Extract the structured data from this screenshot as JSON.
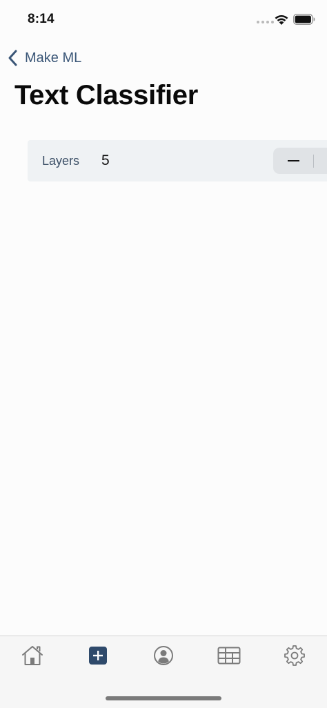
{
  "status_bar": {
    "time": "8:14"
  },
  "nav": {
    "back_label": "Make ML",
    "title": "Text Classifier"
  },
  "layers": {
    "label": "Layers",
    "value": "5"
  },
  "tab_bar": {
    "items": [
      {
        "icon": "home-icon",
        "selected": false
      },
      {
        "icon": "add-square-icon",
        "selected": true
      },
      {
        "icon": "user-circle-icon",
        "selected": false
      },
      {
        "icon": "table-icon",
        "selected": false
      },
      {
        "icon": "gear-icon",
        "selected": false
      }
    ]
  },
  "colors": {
    "accent": "#2f4a6b",
    "back_text": "#3a5677",
    "row_bg": "#eff2f4",
    "icon_gray": "#7b7b7b"
  }
}
